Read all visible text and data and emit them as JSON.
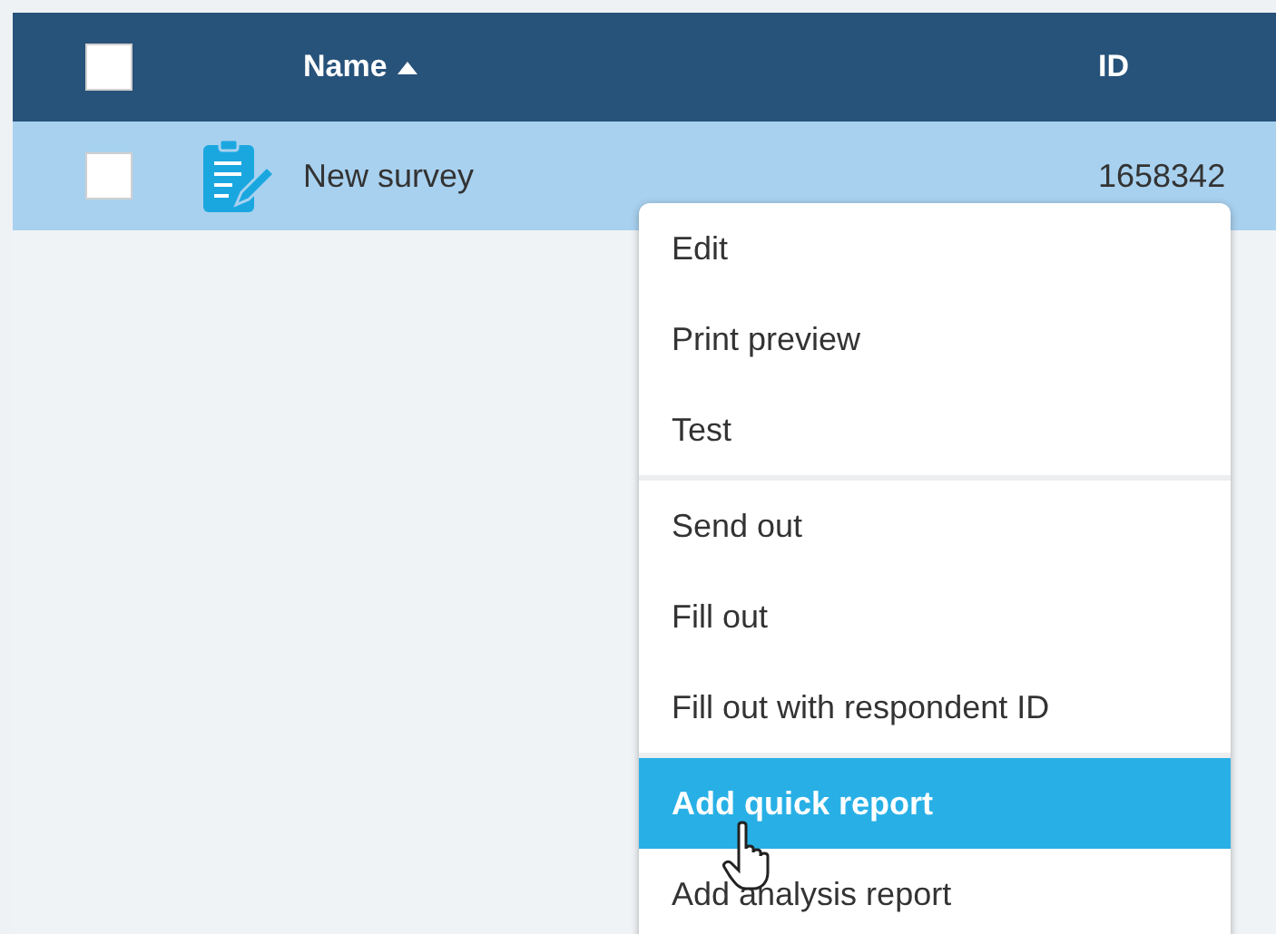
{
  "table": {
    "select_all_checked": false,
    "columns": [
      {
        "label": "Name",
        "sorted": true
      },
      {
        "label": "ID",
        "sorted": false
      }
    ],
    "rows": [
      {
        "checked": false,
        "selected": true,
        "name": "New survey",
        "id": "1658342"
      }
    ]
  },
  "context_menu": {
    "groups": [
      [
        {
          "label": "Edit",
          "selected": false
        },
        {
          "label": "Print preview",
          "selected": false
        },
        {
          "label": "Test",
          "selected": false
        }
      ],
      [
        {
          "label": "Send out",
          "selected": false
        },
        {
          "label": "Fill out",
          "selected": false
        },
        {
          "label": "Fill out with respondent ID",
          "selected": false
        }
      ],
      [
        {
          "label": "Add quick report",
          "selected": true
        },
        {
          "label": "Add analysis report",
          "selected": false
        }
      ]
    ]
  }
}
